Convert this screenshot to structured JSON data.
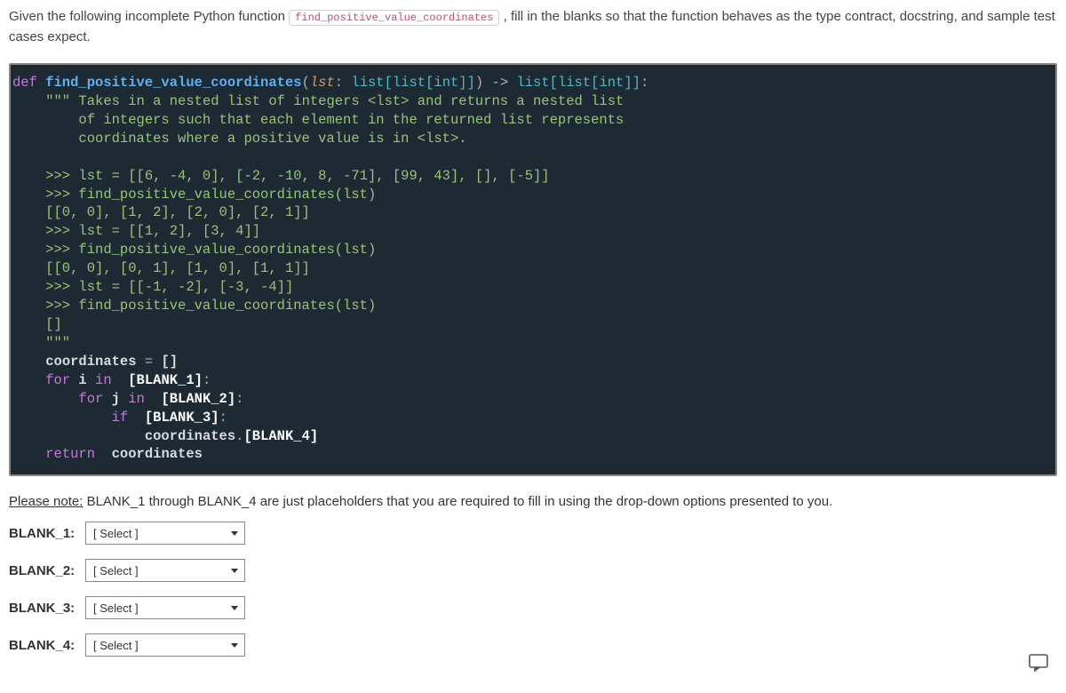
{
  "prompt": {
    "before_code": "Given the following incomplete Python function ",
    "inline_code": "find_positive_value_coordinates",
    "after_code": ", fill in the blanks so that the function behaves as the type contract, docstring, and sample test cases expect."
  },
  "code": {
    "def_kw": "def",
    "fn_name": " find_positive_value_coordinates",
    "sig_open": "(",
    "param_name": "lst",
    "colon_space": ": ",
    "type_in": "list[list[int]]",
    "sig_close_arrow": ") -> ",
    "type_out": "list[list[int]]",
    "sig_end": ":",
    "doc_open": "    \"\"\" ",
    "doc_l1": "Takes in a nested list of integers <lst> and returns a nested list",
    "doc_l2": "        of integers such that each element in the returned list represents",
    "doc_l3": "        coordinates where a positive value is in <lst>.",
    "ex1_a": "    >>> lst = [[6, -4, 0], [-2, -10, 8, -71], [99, 43], [], [-5]]",
    "ex1_b": "    >>> find_positive_value_coordinates(lst)",
    "ex1_c": "    [[0, 0], [1, 2], [2, 0], [2, 1]]",
    "ex2_a": "    >>> lst = [[1, 2], [3, 4]]",
    "ex2_b": "    >>> find_positive_value_coordinates(lst)",
    "ex2_c": "    [[0, 0], [0, 1], [1, 0], [1, 1]]",
    "ex3_a": "    >>> lst = [[-1, -2], [-3, -4]]",
    "ex3_b": "    >>> find_positive_value_coordinates(lst)",
    "ex3_c": "    []",
    "doc_close": "    \"\"\"",
    "body_coord": "coordinates",
    "eq": " = ",
    "empty_list": "[]",
    "for_kw": "for",
    "i_var": " i ",
    "in_kw": "in",
    "blank1": "  [BLANK_1]",
    "colon": ":",
    "j_var": " j ",
    "blank2": "  [BLANK_2]",
    "if_kw": "if",
    "blank3": "  [BLANK_3]",
    "dot": ".",
    "blank4": "[BLANK_4]",
    "return_kw": "return",
    "return_var": "  coordinates"
  },
  "note": {
    "label": "Please note:",
    "text": " BLANK_1 through BLANK_4 are just placeholders that you are required to fill in using the drop-down options presented to you."
  },
  "blanks": [
    {
      "label": "BLANK_1:",
      "placeholder": "[ Select ]"
    },
    {
      "label": "BLANK_2:",
      "placeholder": "[ Select ]"
    },
    {
      "label": "BLANK_3:",
      "placeholder": "[ Select ]"
    },
    {
      "label": "BLANK_4:",
      "placeholder": "[ Select ]"
    }
  ]
}
